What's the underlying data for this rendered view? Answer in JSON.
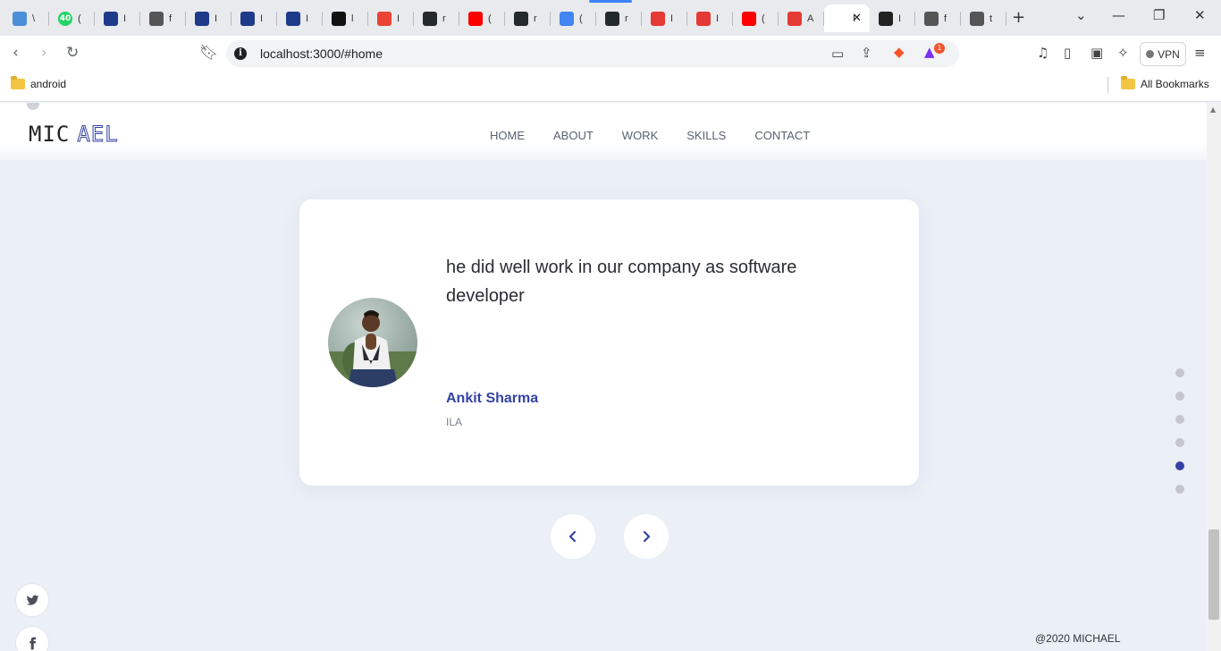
{
  "browser": {
    "tabs": [
      {
        "icon": "snowflake-icon",
        "color": "#4a90d9",
        "glyph": "\\"
      },
      {
        "icon": "whatsapp-badge-icon",
        "color": "#25d366",
        "glyph": "(",
        "badge": "40"
      },
      {
        "icon": "nxt-wave-icon",
        "color": "#1e3a8a",
        "glyph": "I"
      },
      {
        "icon": "globe-icon",
        "color": "#555555",
        "glyph": "f"
      },
      {
        "icon": "nxt-wave-icon",
        "color": "#1e3a8a",
        "glyph": "I"
      },
      {
        "icon": "nxt-wave-icon",
        "color": "#1e3a8a",
        "glyph": "I"
      },
      {
        "icon": "nxt-wave-icon",
        "color": "#1e3a8a",
        "glyph": "I"
      },
      {
        "icon": "hackerrank-icon",
        "color": "#111111",
        "glyph": "l"
      },
      {
        "icon": "gmail-icon",
        "color": "#ea4335",
        "glyph": "I"
      },
      {
        "icon": "github-icon",
        "color": "#24292e",
        "glyph": "r"
      },
      {
        "icon": "youtube-icon",
        "color": "#ff0000",
        "glyph": "("
      },
      {
        "icon": "github-icon",
        "color": "#24292e",
        "glyph": "r"
      },
      {
        "icon": "google-icon",
        "color": "#4285f4",
        "glyph": "("
      },
      {
        "icon": "github-icon",
        "color": "#24292e",
        "glyph": "r"
      },
      {
        "icon": "s-app-icon",
        "color": "#e53935",
        "glyph": "I"
      },
      {
        "icon": "s-app-icon",
        "color": "#e53935",
        "glyph": "I"
      },
      {
        "icon": "youtube-icon",
        "color": "#ff0000",
        "glyph": "("
      },
      {
        "icon": "s-app-icon",
        "color": "#e53935",
        "glyph": "A"
      },
      {
        "icon": "active-tab-icon",
        "color": "#ffffff",
        "glyph": "I",
        "active": true
      },
      {
        "icon": "react-icon",
        "color": "#222222",
        "glyph": "I"
      },
      {
        "icon": "globe-icon",
        "color": "#555555",
        "glyph": "f"
      },
      {
        "icon": "globe-icon",
        "color": "#555555",
        "glyph": "t"
      }
    ],
    "url": "localhost:3000/#home",
    "vpn_label": "VPN",
    "brave_badge": "1",
    "bookmarks": [
      {
        "label": "android"
      },
      {
        "label": "All Bookmarks"
      }
    ]
  },
  "site": {
    "logo_left": "MIC",
    "logo_right": "AEL",
    "nav": [
      "HOME",
      "ABOUT",
      "WORK",
      "SKILLS",
      "CONTACT"
    ],
    "testimonial": {
      "quote": "he did well work in our company as software developer",
      "author": "Ankit Sharma",
      "company": "ILA"
    },
    "dots_count": 6,
    "active_dot": 4,
    "copyright": "@2020 MICHAEL",
    "colors": {
      "accent": "#3442a4",
      "background": "#ebeff6"
    }
  }
}
